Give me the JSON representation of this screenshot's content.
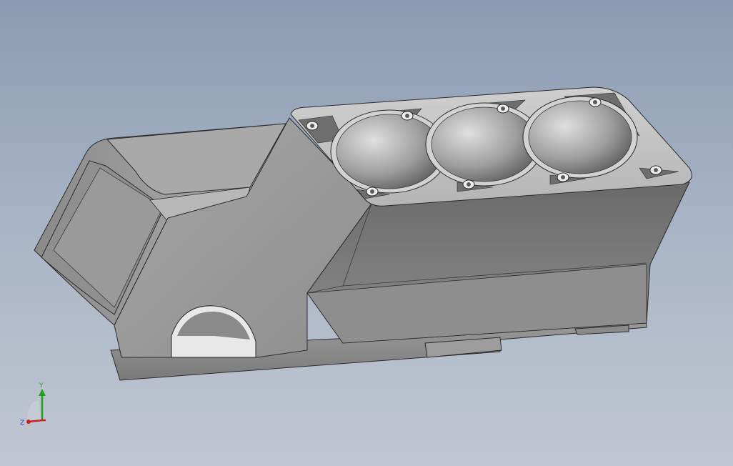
{
  "viewport": {
    "background_top": "#8a9bb3",
    "background_bottom": "#c1c7d2"
  },
  "model": {
    "name": "",
    "cylinder_count": 3
  },
  "triad": {
    "y_label": "Y",
    "z_label": "Z",
    "x_color": "#cc2020",
    "y_color": "#20a020",
    "z_color": "#2040d0"
  }
}
